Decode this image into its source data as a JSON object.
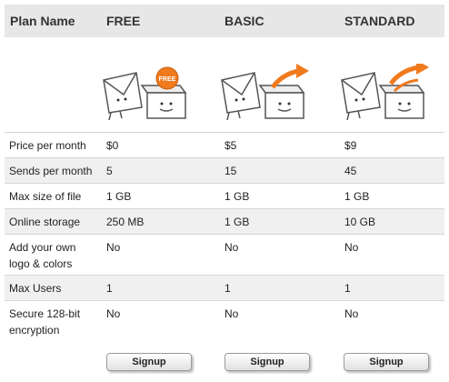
{
  "header": {
    "plan_name": "Plan Name",
    "plans": [
      "FREE",
      "BASIC",
      "STANDARD"
    ]
  },
  "icons": [
    {
      "name": "free-mail-box-icon",
      "badge_text": "FREE",
      "accent": "#f07a1e"
    },
    {
      "name": "basic-mail-box-icon",
      "accent": "#f07a1e"
    },
    {
      "name": "standard-mail-box-icon",
      "accent": "#f07a1e"
    }
  ],
  "rows": [
    {
      "label": "Price per month",
      "free": "$0",
      "basic": "$5",
      "standard": "$9"
    },
    {
      "label": "Sends per month",
      "free": "5",
      "basic": "15",
      "standard": "45"
    },
    {
      "label": "Max size of file",
      "free": "1 GB",
      "basic": "1 GB",
      "standard": "1 GB"
    },
    {
      "label": "Online storage",
      "free": "250 MB",
      "basic": "1 GB",
      "standard": "10 GB"
    },
    {
      "label_line1": "Add your own",
      "label_line2": "logo & colors",
      "free": "No",
      "basic": "No",
      "standard": "No"
    },
    {
      "label": "Max Users",
      "free": "1",
      "basic": "1",
      "standard": "1"
    },
    {
      "label_line1": "Secure 128-bit",
      "label_line2": "encryption",
      "free": "No",
      "basic": "No",
      "standard": "No"
    }
  ],
  "actions": {
    "signup_label": "Signup"
  }
}
